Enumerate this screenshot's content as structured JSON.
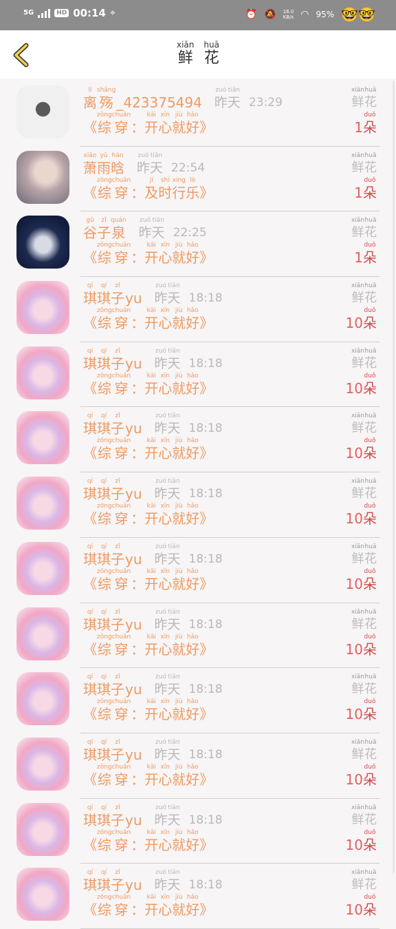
{
  "status_bar": {
    "network": "5G",
    "hd": "HD",
    "time": "00:14",
    "speed": "16.0\nKB/s",
    "battery": "95%",
    "emoji": "🤓🤓"
  },
  "header": {
    "back_icon": "chevron-left-icon",
    "title": [
      {
        "py": "xiān",
        "ch": "鲜"
      },
      {
        "py": "huā",
        "ch": "花"
      }
    ]
  },
  "rows": [
    {
      "avatar": "a",
      "name": [
        {
          "py": "lí",
          "ch": "离"
        },
        {
          "py": "shāng",
          "ch": "殇"
        }
      ],
      "name_extra": "_423375494",
      "when": [
        {
          "py": "zuó",
          "ch": "昨"
        },
        {
          "py": "tiān",
          "ch": "天"
        }
      ],
      "time": "23:29",
      "msg": [
        [
          {
            "py": "zōng",
            "ch": "综"
          },
          {
            "py": "chuān",
            "ch": "穿"
          }
        ],
        [
          {
            "py": "kāi",
            "ch": "开"
          },
          {
            "py": "xīn",
            "ch": "心"
          },
          {
            "py": "jiù",
            "ch": "就"
          },
          {
            "py": "hǎo",
            "ch": "好"
          }
        ]
      ],
      "gift": [
        {
          "py": "xiān",
          "ch": "鲜"
        },
        {
          "py": "huā",
          "ch": "花"
        }
      ],
      "count": "1",
      "unit": {
        "py": "duǒ",
        "ch": "朵"
      }
    },
    {
      "avatar": "b",
      "name": [
        {
          "py": "xiāo",
          "ch": "萧"
        },
        {
          "py": "yǔ",
          "ch": "雨"
        },
        {
          "py": "hán",
          "ch": "晗"
        }
      ],
      "name_extra": "",
      "when": [
        {
          "py": "zuó",
          "ch": "昨"
        },
        {
          "py": "tiān",
          "ch": "天"
        }
      ],
      "time": "22:54",
      "msg": [
        [
          {
            "py": "zōng",
            "ch": "综"
          },
          {
            "py": "chuān",
            "ch": "穿"
          }
        ],
        [
          {
            "py": "jí",
            "ch": "及"
          },
          {
            "py": "shí",
            "ch": "时"
          },
          {
            "py": "xíng",
            "ch": "行"
          },
          {
            "py": "lè",
            "ch": "乐"
          }
        ]
      ],
      "gift": [
        {
          "py": "xiān",
          "ch": "鲜"
        },
        {
          "py": "huā",
          "ch": "花"
        }
      ],
      "count": "1",
      "unit": {
        "py": "duǒ",
        "ch": "朵"
      }
    },
    {
      "avatar": "c",
      "name": [
        {
          "py": "gǔ",
          "ch": "谷"
        },
        {
          "py": "zǐ",
          "ch": "子"
        },
        {
          "py": "quán",
          "ch": "泉"
        }
      ],
      "name_extra": "",
      "when": [
        {
          "py": "zuó",
          "ch": "昨"
        },
        {
          "py": "tiān",
          "ch": "天"
        }
      ],
      "time": "22:25",
      "msg": [
        [
          {
            "py": "zōng",
            "ch": "综"
          },
          {
            "py": "chuān",
            "ch": "穿"
          }
        ],
        [
          {
            "py": "kāi",
            "ch": "开"
          },
          {
            "py": "xīn",
            "ch": "心"
          },
          {
            "py": "jiù",
            "ch": "就"
          },
          {
            "py": "hǎo",
            "ch": "好"
          }
        ]
      ],
      "gift": [
        {
          "py": "xiān",
          "ch": "鲜"
        },
        {
          "py": "huā",
          "ch": "花"
        }
      ],
      "count": "1",
      "unit": {
        "py": "duǒ",
        "ch": "朵"
      }
    },
    {
      "avatar": "d",
      "name": [
        {
          "py": "qí",
          "ch": "琪"
        },
        {
          "py": "qí",
          "ch": "琪"
        },
        {
          "py": "zǐ",
          "ch": "子"
        }
      ],
      "name_extra": "yu",
      "when": [
        {
          "py": "zuó",
          "ch": "昨"
        },
        {
          "py": "tiān",
          "ch": "天"
        }
      ],
      "time": "18:18",
      "msg": [
        [
          {
            "py": "zōng",
            "ch": "综"
          },
          {
            "py": "chuān",
            "ch": "穿"
          }
        ],
        [
          {
            "py": "kāi",
            "ch": "开"
          },
          {
            "py": "xīn",
            "ch": "心"
          },
          {
            "py": "jiù",
            "ch": "就"
          },
          {
            "py": "hǎo",
            "ch": "好"
          }
        ]
      ],
      "gift": [
        {
          "py": "xiān",
          "ch": "鲜"
        },
        {
          "py": "huā",
          "ch": "花"
        }
      ],
      "count": "10",
      "unit": {
        "py": "duǒ",
        "ch": "朵"
      }
    },
    {
      "avatar": "d",
      "name": [
        {
          "py": "qí",
          "ch": "琪"
        },
        {
          "py": "qí",
          "ch": "琪"
        },
        {
          "py": "zǐ",
          "ch": "子"
        }
      ],
      "name_extra": "yu",
      "when": [
        {
          "py": "zuó",
          "ch": "昨"
        },
        {
          "py": "tiān",
          "ch": "天"
        }
      ],
      "time": "18:18",
      "msg": [
        [
          {
            "py": "zōng",
            "ch": "综"
          },
          {
            "py": "chuān",
            "ch": "穿"
          }
        ],
        [
          {
            "py": "kāi",
            "ch": "开"
          },
          {
            "py": "xīn",
            "ch": "心"
          },
          {
            "py": "jiù",
            "ch": "就"
          },
          {
            "py": "hǎo",
            "ch": "好"
          }
        ]
      ],
      "gift": [
        {
          "py": "xiān",
          "ch": "鲜"
        },
        {
          "py": "huā",
          "ch": "花"
        }
      ],
      "count": "10",
      "unit": {
        "py": "duǒ",
        "ch": "朵"
      }
    },
    {
      "avatar": "d",
      "name": [
        {
          "py": "qí",
          "ch": "琪"
        },
        {
          "py": "qí",
          "ch": "琪"
        },
        {
          "py": "zǐ",
          "ch": "子"
        }
      ],
      "name_extra": "yu",
      "when": [
        {
          "py": "zuó",
          "ch": "昨"
        },
        {
          "py": "tiān",
          "ch": "天"
        }
      ],
      "time": "18:18",
      "msg": [
        [
          {
            "py": "zōng",
            "ch": "综"
          },
          {
            "py": "chuān",
            "ch": "穿"
          }
        ],
        [
          {
            "py": "kāi",
            "ch": "开"
          },
          {
            "py": "xīn",
            "ch": "心"
          },
          {
            "py": "jiù",
            "ch": "就"
          },
          {
            "py": "hǎo",
            "ch": "好"
          }
        ]
      ],
      "gift": [
        {
          "py": "xiān",
          "ch": "鲜"
        },
        {
          "py": "huā",
          "ch": "花"
        }
      ],
      "count": "10",
      "unit": {
        "py": "duǒ",
        "ch": "朵"
      }
    },
    {
      "avatar": "d",
      "name": [
        {
          "py": "qí",
          "ch": "琪"
        },
        {
          "py": "qí",
          "ch": "琪"
        },
        {
          "py": "zǐ",
          "ch": "子"
        }
      ],
      "name_extra": "yu",
      "when": [
        {
          "py": "zuó",
          "ch": "昨"
        },
        {
          "py": "tiān",
          "ch": "天"
        }
      ],
      "time": "18:18",
      "msg": [
        [
          {
            "py": "zōng",
            "ch": "综"
          },
          {
            "py": "chuān",
            "ch": "穿"
          }
        ],
        [
          {
            "py": "kāi",
            "ch": "开"
          },
          {
            "py": "xīn",
            "ch": "心"
          },
          {
            "py": "jiù",
            "ch": "就"
          },
          {
            "py": "hǎo",
            "ch": "好"
          }
        ]
      ],
      "gift": [
        {
          "py": "xiān",
          "ch": "鲜"
        },
        {
          "py": "huā",
          "ch": "花"
        }
      ],
      "count": "10",
      "unit": {
        "py": "duǒ",
        "ch": "朵"
      }
    },
    {
      "avatar": "d",
      "name": [
        {
          "py": "qí",
          "ch": "琪"
        },
        {
          "py": "qí",
          "ch": "琪"
        },
        {
          "py": "zǐ",
          "ch": "子"
        }
      ],
      "name_extra": "yu",
      "when": [
        {
          "py": "zuó",
          "ch": "昨"
        },
        {
          "py": "tiān",
          "ch": "天"
        }
      ],
      "time": "18:18",
      "msg": [
        [
          {
            "py": "zōng",
            "ch": "综"
          },
          {
            "py": "chuān",
            "ch": "穿"
          }
        ],
        [
          {
            "py": "kāi",
            "ch": "开"
          },
          {
            "py": "xīn",
            "ch": "心"
          },
          {
            "py": "jiù",
            "ch": "就"
          },
          {
            "py": "hǎo",
            "ch": "好"
          }
        ]
      ],
      "gift": [
        {
          "py": "xiān",
          "ch": "鲜"
        },
        {
          "py": "huā",
          "ch": "花"
        }
      ],
      "count": "10",
      "unit": {
        "py": "duǒ",
        "ch": "朵"
      }
    },
    {
      "avatar": "d",
      "name": [
        {
          "py": "qí",
          "ch": "琪"
        },
        {
          "py": "qí",
          "ch": "琪"
        },
        {
          "py": "zǐ",
          "ch": "子"
        }
      ],
      "name_extra": "yu",
      "when": [
        {
          "py": "zuó",
          "ch": "昨"
        },
        {
          "py": "tiān",
          "ch": "天"
        }
      ],
      "time": "18:18",
      "msg": [
        [
          {
            "py": "zōng",
            "ch": "综"
          },
          {
            "py": "chuān",
            "ch": "穿"
          }
        ],
        [
          {
            "py": "kāi",
            "ch": "开"
          },
          {
            "py": "xīn",
            "ch": "心"
          },
          {
            "py": "jiù",
            "ch": "就"
          },
          {
            "py": "hǎo",
            "ch": "好"
          }
        ]
      ],
      "gift": [
        {
          "py": "xiān",
          "ch": "鲜"
        },
        {
          "py": "huā",
          "ch": "花"
        }
      ],
      "count": "10",
      "unit": {
        "py": "duǒ",
        "ch": "朵"
      }
    },
    {
      "avatar": "d",
      "name": [
        {
          "py": "qí",
          "ch": "琪"
        },
        {
          "py": "qí",
          "ch": "琪"
        },
        {
          "py": "zǐ",
          "ch": "子"
        }
      ],
      "name_extra": "yu",
      "when": [
        {
          "py": "zuó",
          "ch": "昨"
        },
        {
          "py": "tiān",
          "ch": "天"
        }
      ],
      "time": "18:18",
      "msg": [
        [
          {
            "py": "zōng",
            "ch": "综"
          },
          {
            "py": "chuān",
            "ch": "穿"
          }
        ],
        [
          {
            "py": "kāi",
            "ch": "开"
          },
          {
            "py": "xīn",
            "ch": "心"
          },
          {
            "py": "jiù",
            "ch": "就"
          },
          {
            "py": "hǎo",
            "ch": "好"
          }
        ]
      ],
      "gift": [
        {
          "py": "xiān",
          "ch": "鲜"
        },
        {
          "py": "huā",
          "ch": "花"
        }
      ],
      "count": "10",
      "unit": {
        "py": "duǒ",
        "ch": "朵"
      }
    },
    {
      "avatar": "d",
      "name": [
        {
          "py": "qí",
          "ch": "琪"
        },
        {
          "py": "qí",
          "ch": "琪"
        },
        {
          "py": "zǐ",
          "ch": "子"
        }
      ],
      "name_extra": "yu",
      "when": [
        {
          "py": "zuó",
          "ch": "昨"
        },
        {
          "py": "tiān",
          "ch": "天"
        }
      ],
      "time": "18:18",
      "msg": [
        [
          {
            "py": "zōng",
            "ch": "综"
          },
          {
            "py": "chuān",
            "ch": "穿"
          }
        ],
        [
          {
            "py": "kāi",
            "ch": "开"
          },
          {
            "py": "xīn",
            "ch": "心"
          },
          {
            "py": "jiù",
            "ch": "就"
          },
          {
            "py": "hǎo",
            "ch": "好"
          }
        ]
      ],
      "gift": [
        {
          "py": "xiān",
          "ch": "鲜"
        },
        {
          "py": "huā",
          "ch": "花"
        }
      ],
      "count": "10",
      "unit": {
        "py": "duǒ",
        "ch": "朵"
      }
    },
    {
      "avatar": "d",
      "name": [
        {
          "py": "qí",
          "ch": "琪"
        },
        {
          "py": "qí",
          "ch": "琪"
        },
        {
          "py": "zǐ",
          "ch": "子"
        }
      ],
      "name_extra": "yu",
      "when": [
        {
          "py": "zuó",
          "ch": "昨"
        },
        {
          "py": "tiān",
          "ch": "天"
        }
      ],
      "time": "18:18",
      "msg": [
        [
          {
            "py": "zōng",
            "ch": "综"
          },
          {
            "py": "chuān",
            "ch": "穿"
          }
        ],
        [
          {
            "py": "kāi",
            "ch": "开"
          },
          {
            "py": "xīn",
            "ch": "心"
          },
          {
            "py": "jiù",
            "ch": "就"
          },
          {
            "py": "hǎo",
            "ch": "好"
          }
        ]
      ],
      "gift": [
        {
          "py": "xiān",
          "ch": "鲜"
        },
        {
          "py": "huā",
          "ch": "花"
        }
      ],
      "count": "10",
      "unit": {
        "py": "duǒ",
        "ch": "朵"
      }
    },
    {
      "avatar": "d",
      "name": [
        {
          "py": "qí",
          "ch": "琪"
        },
        {
          "py": "qí",
          "ch": "琪"
        },
        {
          "py": "zǐ",
          "ch": "子"
        }
      ],
      "name_extra": "yu",
      "when": [
        {
          "py": "zuó",
          "ch": "昨"
        },
        {
          "py": "tiān",
          "ch": "天"
        }
      ],
      "time": "18:18",
      "msg": [
        [
          {
            "py": "zōng",
            "ch": "综"
          },
          {
            "py": "chuān",
            "ch": "穿"
          }
        ],
        [
          {
            "py": "kāi",
            "ch": "开"
          },
          {
            "py": "xīn",
            "ch": "心"
          },
          {
            "py": "jiù",
            "ch": "就"
          },
          {
            "py": "hǎo",
            "ch": "好"
          }
        ]
      ],
      "gift": [
        {
          "py": "xiān",
          "ch": "鲜"
        },
        {
          "py": "huā",
          "ch": "花"
        }
      ],
      "count": "10",
      "unit": {
        "py": "duǒ",
        "ch": "朵"
      }
    }
  ],
  "colors": {
    "name": "#ee9a62",
    "time": "#b9b9b9",
    "count": "#d24a4a",
    "header_bg": "#ffffff",
    "status_bg": "#8c8c8c"
  }
}
